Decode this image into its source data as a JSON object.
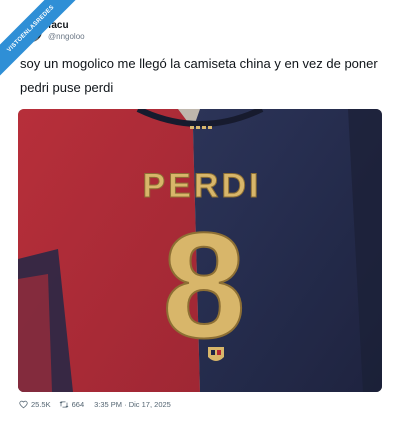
{
  "badge": {
    "label": "VISTOENLASREDES"
  },
  "user": {
    "display_name": "facu",
    "handle": "@nngoloo"
  },
  "tweet": {
    "text": "soy un mogolico me llegó la camiseta china y en vez de poner pedri puse perdi"
  },
  "jersey": {
    "name": "PERDI",
    "number": "8"
  },
  "footer": {
    "likes": "25.5K",
    "retweets": "664",
    "timestamp": "3:35 PM · Dic 17, 2025"
  },
  "colors": {
    "red": "#c0323a",
    "navy": "#1c2446",
    "gold": "#d8b66a",
    "badge": "#2f8fd6"
  }
}
